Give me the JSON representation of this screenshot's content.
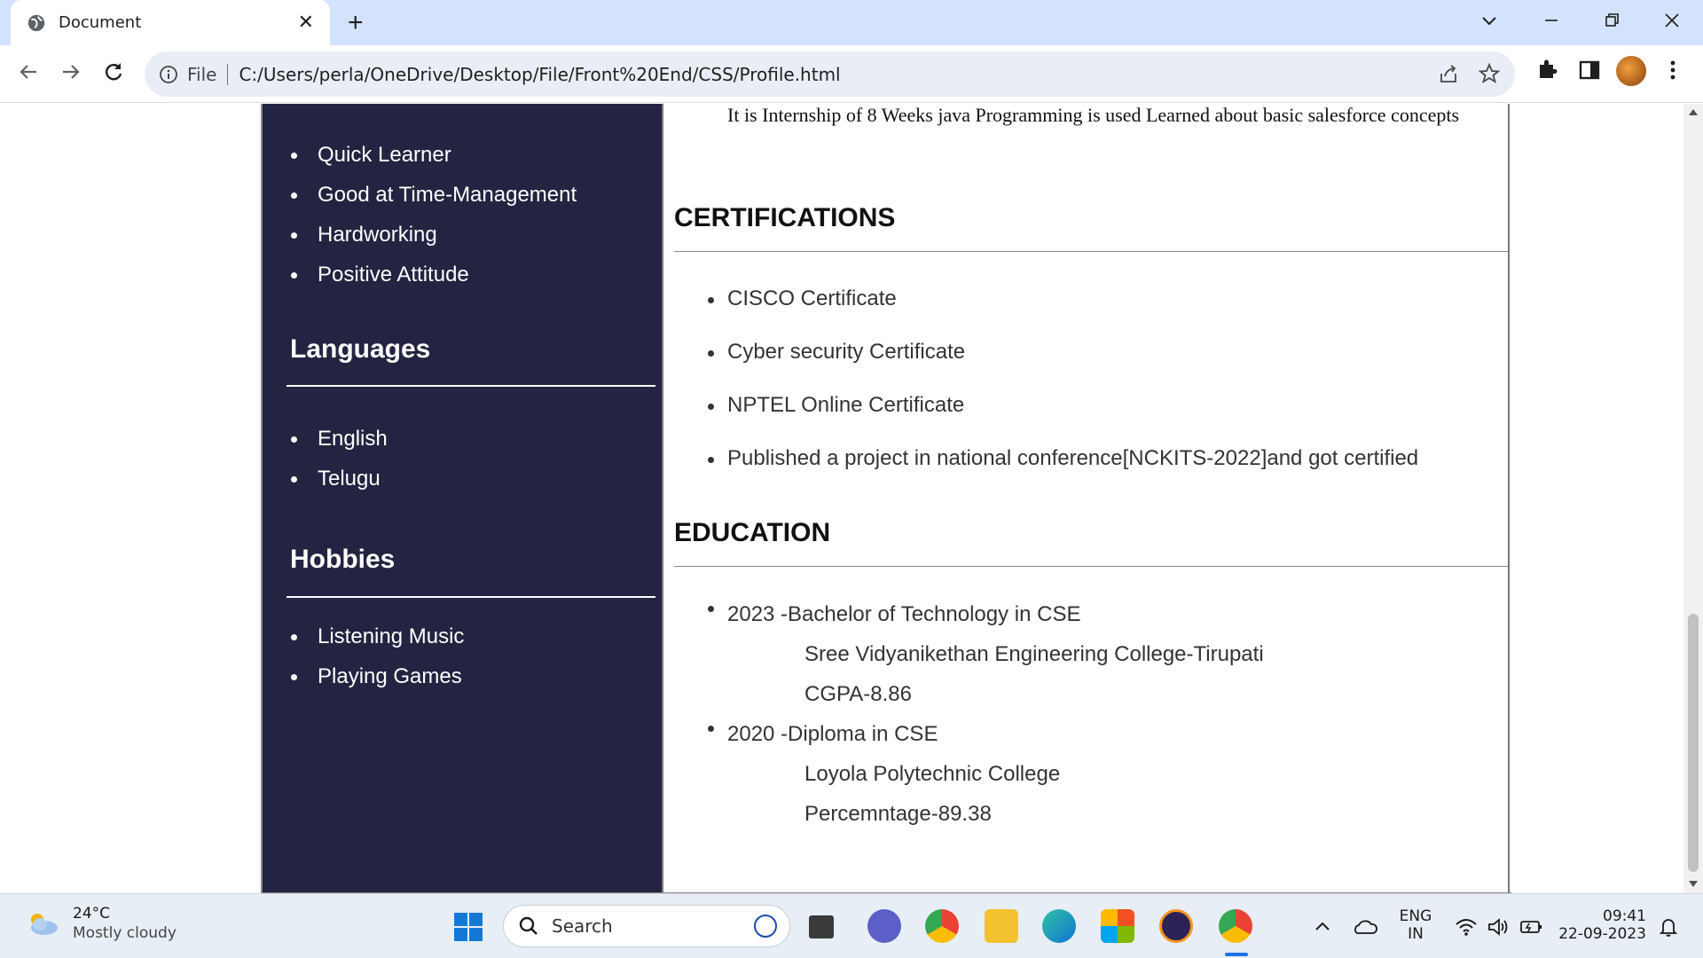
{
  "browser": {
    "tab_title": "Document",
    "tab_close": "✕",
    "new_tab": "+",
    "url_scheme": "File",
    "url": "C:/Users/perla/OneDrive/Desktop/File/Front%20End/CSS/Profile.html"
  },
  "sidebar": {
    "strengths": [
      "Quick Learner",
      "Good at Time-Management",
      "Hardworking",
      "Positive Attitude"
    ],
    "languages_title": "Languages",
    "languages": [
      "English",
      "Telugu"
    ],
    "hobbies_title": "Hobbies",
    "hobbies": [
      "Listening Music",
      "Playing Games"
    ]
  },
  "main": {
    "internship_text": "It is Internship of 8 Weeks java Programming is used Learned about basic salesforce concepts",
    "certifications_title": "CERTIFICATIONS",
    "certifications": [
      "CISCO Certificate",
      "Cyber security Certificate",
      "NPTEL Online Certificate",
      "Published a project in national conference[NCKITS-2022]and got certified"
    ],
    "education_title": "EDUCATION",
    "education": [
      {
        "degree": "2023 -Bachelor of Technology in CSE",
        "institution": "Sree Vidyanikethan Engineering College-Tirupati",
        "score": "CGPA-8.86"
      },
      {
        "degree": "2020 -Diploma in CSE",
        "institution": "Loyola Polytechnic College",
        "score": "Percemntage-89.38"
      }
    ]
  },
  "taskbar": {
    "temperature": "24°C",
    "weather": "Mostly cloudy",
    "search_label": "Search",
    "lang_top": "ENG",
    "lang_bottom": "IN",
    "time": "09:41",
    "date": "22-09-2023"
  },
  "colors": {
    "sidebar_bg": "#232441",
    "tabbar_bg": "#d3e3fd",
    "taskbar_bg": "#e8eef6"
  }
}
